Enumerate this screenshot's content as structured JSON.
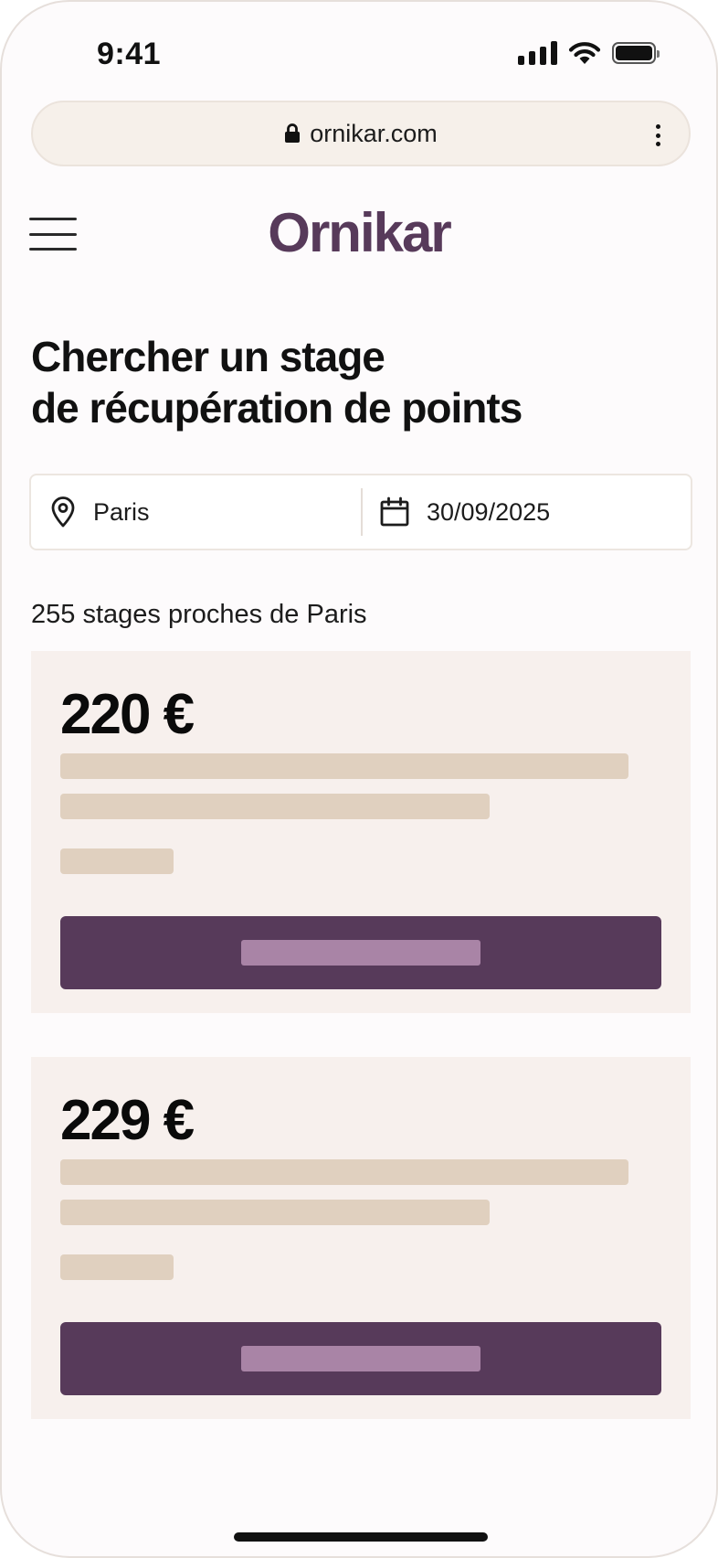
{
  "status_bar": {
    "time": "9:41",
    "icons": [
      "signal-icon",
      "wifi-icon",
      "battery-icon"
    ]
  },
  "browser": {
    "url": "ornikar.com",
    "icons": [
      "lock-icon",
      "more-vertical-icon"
    ]
  },
  "header": {
    "logo": "Ornikar",
    "menu_icon": "hamburger-menu-icon"
  },
  "page": {
    "title": "Chercher un stage\nde récupération de points"
  },
  "search": {
    "location_value": "Paris",
    "location_icon": "map-pin-icon",
    "date_value": "30/09/2025",
    "date_icon": "calendar-icon"
  },
  "results": {
    "count_text": "255 stages proches de Paris",
    "cards": [
      {
        "price": "220 €"
      },
      {
        "price": "229 €"
      }
    ]
  },
  "colors": {
    "brand": "#573a5a",
    "card_bg": "#f7f0ed",
    "placeholder": "#e0d0bf",
    "button_placeholder": "#a984a6"
  }
}
